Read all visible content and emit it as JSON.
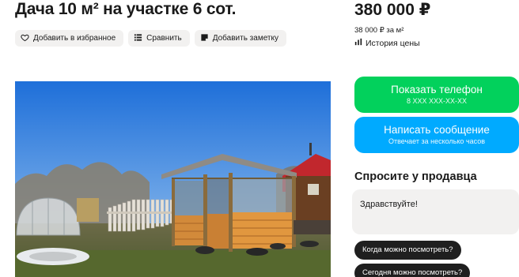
{
  "listing": {
    "title": "Дача 10 м² на участке 6 сот."
  },
  "actions": {
    "favorite_label": "Добавить в избранное",
    "compare_label": "Сравнить",
    "note_label": "Добавить заметку"
  },
  "pricing": {
    "price": "380 000 ₽",
    "price_per_meter": "38 000 ₽ за м²",
    "history_label": "История цены"
  },
  "contact": {
    "phone_label": "Показать телефон",
    "phone_masked": "8 XXX XXX-XX-XX",
    "message_label": "Написать сообщение",
    "message_sub": "Отвечает за несколько часов"
  },
  "ask_seller": {
    "title": "Спросите у продавца",
    "message_value": "Здравствуйте!",
    "quick_questions": [
      "Когда можно посмотреть?",
      "Сегодня можно посмотреть?"
    ]
  },
  "colors": {
    "phone_button": "#02d15c",
    "message_button": "#00aaff",
    "chip_bg": "#1f1f1f",
    "chip_text": "#ffffff",
    "secondary_bg": "#f2f1f0"
  },
  "icons": [
    "heart-icon",
    "compare-icon",
    "note-icon",
    "chart-icon"
  ]
}
